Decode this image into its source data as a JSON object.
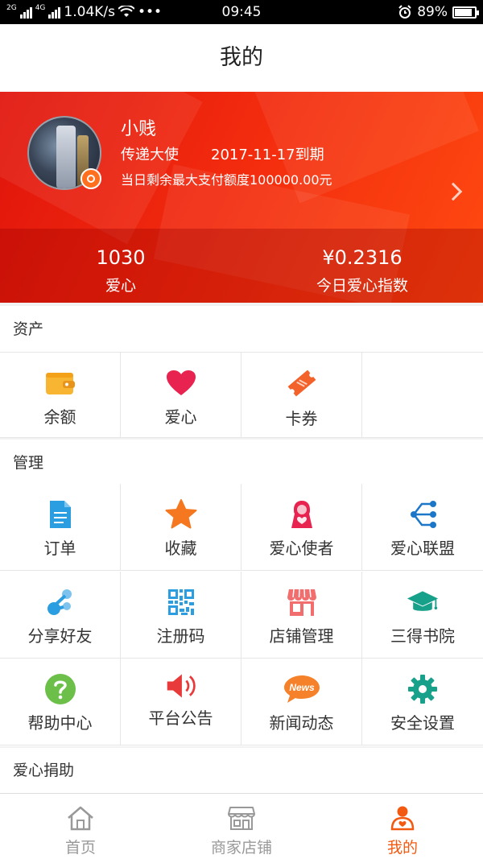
{
  "status_bar": {
    "network_label": "2G",
    "network_label2": "4G",
    "speed": "1.04K/s",
    "more": "•••",
    "time": "09:45",
    "battery": "89%",
    "battery_level": 0.89
  },
  "header": {
    "title": "我的"
  },
  "profile": {
    "name": "小贱",
    "role": "传递大使",
    "expiry": "2017-11-17到期",
    "limit": "当日剩余最大支付额度100000.00元",
    "stats": [
      {
        "value": "1030",
        "label": "爱心"
      },
      {
        "value": "¥0.2316",
        "label": "今日爱心指数"
      }
    ]
  },
  "sections": [
    {
      "title": "资产",
      "items": [
        {
          "label": "余额",
          "icon": "wallet-icon"
        },
        {
          "label": "爱心",
          "icon": "heart-icon"
        },
        {
          "label": "卡券",
          "icon": "ticket-icon"
        }
      ]
    },
    {
      "title": "管理",
      "items": [
        {
          "label": "订单",
          "icon": "document-icon"
        },
        {
          "label": "收藏",
          "icon": "star-icon"
        },
        {
          "label": "爱心使者",
          "icon": "messenger-icon"
        },
        {
          "label": "爱心联盟",
          "icon": "network-icon"
        },
        {
          "label": "分享好友",
          "icon": "share-icon"
        },
        {
          "label": "注册码",
          "icon": "qrcode-icon"
        },
        {
          "label": "店铺管理",
          "icon": "store-icon"
        },
        {
          "label": "三得书院",
          "icon": "graduation-cap-icon"
        },
        {
          "label": "帮助中心",
          "icon": "help-icon"
        },
        {
          "label": "平台公告",
          "icon": "speaker-icon"
        },
        {
          "label": "新闻动态",
          "icon": "news-icon"
        },
        {
          "label": "安全设置",
          "icon": "gear-icon"
        }
      ]
    },
    {
      "title": "爱心捐助"
    }
  ],
  "news_badge": "News",
  "tabbar": [
    {
      "label": "首页",
      "icon": "home-icon",
      "active": false
    },
    {
      "label": "商家店铺",
      "icon": "shop-icon",
      "active": false
    },
    {
      "label": "我的",
      "icon": "user-icon",
      "active": true
    }
  ],
  "colors": {
    "accent": "#f25a12",
    "banner_red": "#e8180c",
    "banner_orange": "#ff4a10",
    "heart": "#e8234f",
    "help_green": "#6cc04a",
    "teal": "#17a08a",
    "blue": "#2a9ee0"
  }
}
